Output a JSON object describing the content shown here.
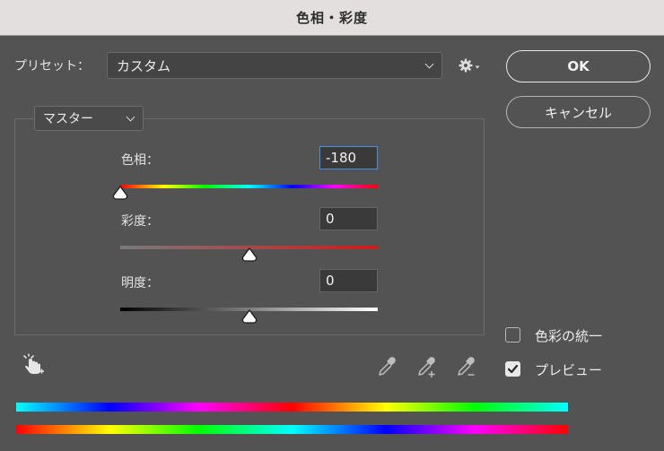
{
  "window": {
    "title": "色相・彩度"
  },
  "preset": {
    "label": "プリセット：",
    "value": "カスタム"
  },
  "buttons": {
    "ok": "OK",
    "cancel": "キャンセル"
  },
  "channel": {
    "value": "マスター"
  },
  "hue": {
    "label": "色相：",
    "value": "-180",
    "level": 0.0
  },
  "saturation": {
    "label": "彩度：",
    "value": "0",
    "level": 0.5
  },
  "lightness": {
    "label": "明度：",
    "value": "0",
    "level": 0.5
  },
  "options": {
    "colorize": {
      "label": "色彩の統一",
      "checked": false
    },
    "preview": {
      "label": "プレビュー",
      "checked": true
    }
  },
  "icons": {
    "gear": "gear-icon",
    "hand": "targeted-adjustment-hand-icon",
    "eyedropper": "eyedropper-icon",
    "eyedropper_add": "eyedropper-plus-icon",
    "eyedropper_subtract": "eyedropper-minus-icon"
  },
  "colors": {
    "focus": "#4a8fe0",
    "background": "#535353",
    "titlebar": "#e3dfdf"
  }
}
